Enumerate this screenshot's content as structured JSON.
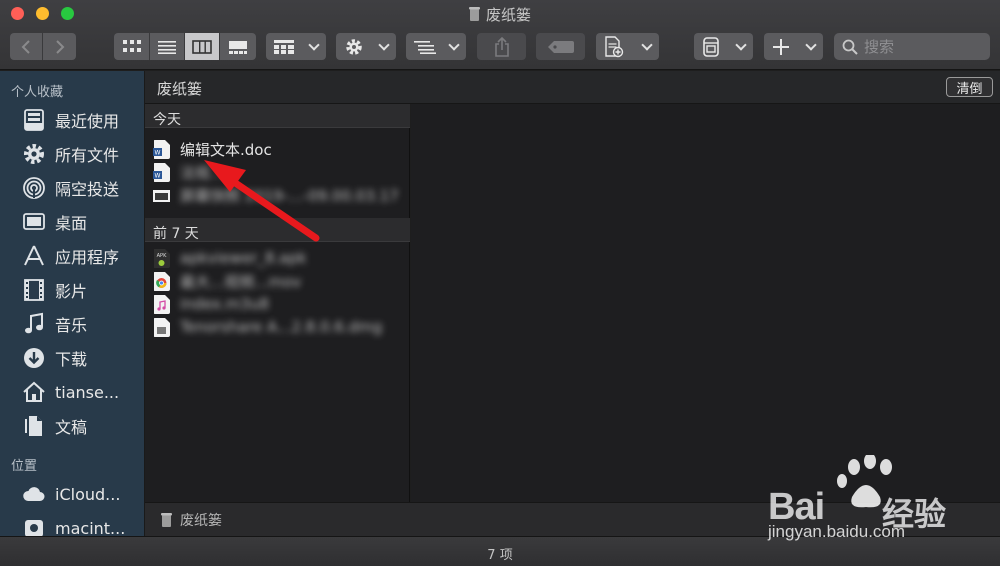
{
  "window": {
    "title": "废纸篓"
  },
  "toolbar": {
    "search_placeholder": "搜索"
  },
  "sidebar": {
    "section_favorites": "个人收藏",
    "favorites": [
      {
        "label": "最近使用",
        "icon": "recents-icon"
      },
      {
        "label": "所有文件",
        "icon": "gear-icon"
      },
      {
        "label": "隔空投送",
        "icon": "airdrop-icon"
      },
      {
        "label": "桌面",
        "icon": "desktop-icon"
      },
      {
        "label": "应用程序",
        "icon": "applications-icon"
      },
      {
        "label": "影片",
        "icon": "movies-icon"
      },
      {
        "label": "音乐",
        "icon": "music-icon"
      },
      {
        "label": "下载",
        "icon": "downloads-icon"
      },
      {
        "label": "tianse...",
        "icon": "home-icon"
      },
      {
        "label": "文稿",
        "icon": "documents-icon"
      }
    ],
    "section_locations": "位置",
    "locations": [
      {
        "label": "iCloud...",
        "icon": "icloud-icon"
      },
      {
        "label": "macint...",
        "icon": "disk-icon"
      }
    ]
  },
  "header": {
    "title": "废纸篓",
    "empty_button": "清倒"
  },
  "file_list": {
    "groups": [
      {
        "label": "今天",
        "items": [
          {
            "name": "编辑文本.doc",
            "icon": "word-doc-icon",
            "blurred": false
          },
          {
            "name": "法规...",
            "icon": "word-doc-icon",
            "blurred": true
          },
          {
            "name": "屏幕快照 2019-...-09.00.03.17",
            "icon": "screenshot-icon",
            "blurred": true
          }
        ]
      },
      {
        "label": "前 7 天",
        "items": [
          {
            "name": "apkviewer_8.apk",
            "icon": "apk-icon",
            "blurred": true
          },
          {
            "name": "最大...视频...mov",
            "icon": "chrome-icon",
            "blurred": true
          },
          {
            "name": "index.m3u8",
            "icon": "music-file-icon",
            "blurred": true
          },
          {
            "name": "Tenorshare A...2.8.0.6.dmg",
            "icon": "dmg-icon",
            "blurred": true
          }
        ]
      }
    ]
  },
  "path_bar": {
    "label": "废纸篓"
  },
  "status_bar": {
    "text": "7 项"
  },
  "watermark": {
    "brand_latin": "Bai",
    "brand_cn": "经验",
    "url": "jingyan.baidu.com"
  },
  "colors": {
    "sidebar_bg": "#283a4a",
    "arrow": "#e8191d"
  }
}
